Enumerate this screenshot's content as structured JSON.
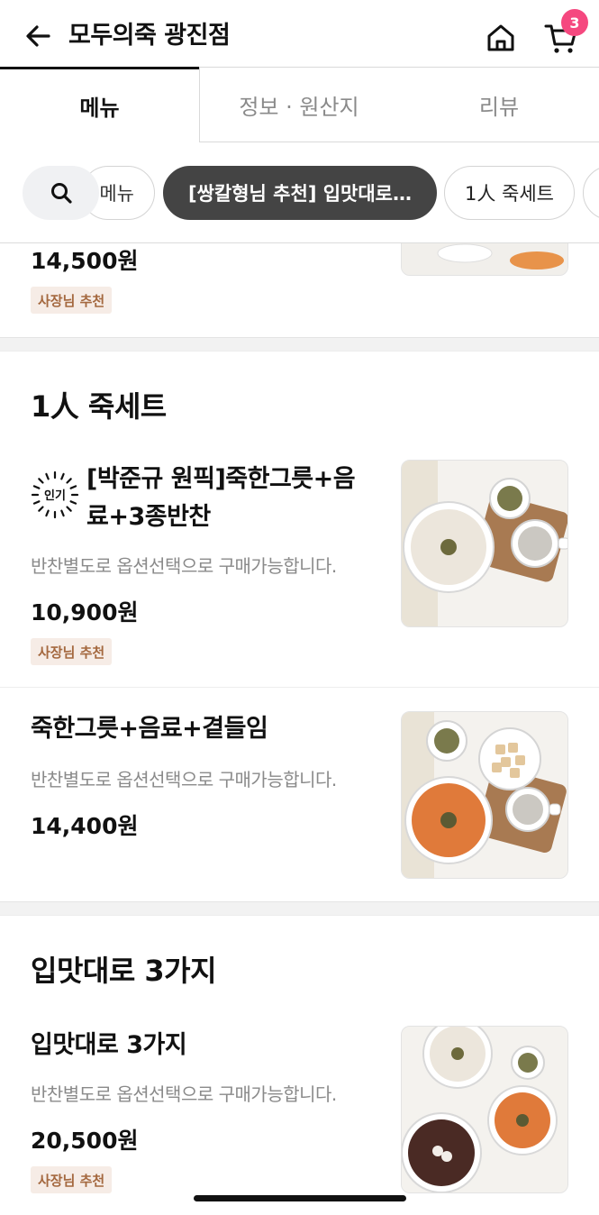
{
  "header": {
    "store_name": "모두의죽 광진점",
    "cart_count": "3"
  },
  "tabs": [
    {
      "label": "메뉴",
      "active": true
    },
    {
      "label": "정보 · 원산지",
      "active": false
    },
    {
      "label": "리뷰",
      "active": false
    }
  ],
  "chips": {
    "partial_label": "메뉴",
    "active_label": "[쌍칼형님 추천] 입맛대로…",
    "set_label": "1人 죽세트"
  },
  "top_item": {
    "price": "14,500원",
    "badge": "사장님 추천"
  },
  "sections": [
    {
      "title": "1人 죽세트",
      "items": [
        {
          "popular_label": "인기",
          "name_line1": "[박준규 원픽]죽한그릇+음",
          "name_line2": "료+3종반찬",
          "desc": "반찬별도로 옵션선택으로 구매가능합니다.",
          "price": "10,900원",
          "badge": "사장님 추천"
        },
        {
          "name": "죽한그릇+음료+곁들임",
          "desc": "반찬별도로 옵션선택으로 구매가능합니다.",
          "price": "14,400원"
        }
      ]
    },
    {
      "title": "입맛대로 3가지",
      "items": [
        {
          "name": "입맛대로 3가지",
          "desc": "반찬별도로 옵션선택으로 구매가능합니다.",
          "price": "20,500원",
          "badge": "사장님 추천"
        }
      ]
    }
  ],
  "colors": {
    "badge_bg": "#f6ece6",
    "badge_text": "#a4683f",
    "cart_badge": "#f5487f",
    "active_chip": "#444444"
  },
  "icons": [
    "back-arrow-icon",
    "home-icon",
    "cart-icon",
    "search-icon",
    "popular-sun-icon"
  ]
}
